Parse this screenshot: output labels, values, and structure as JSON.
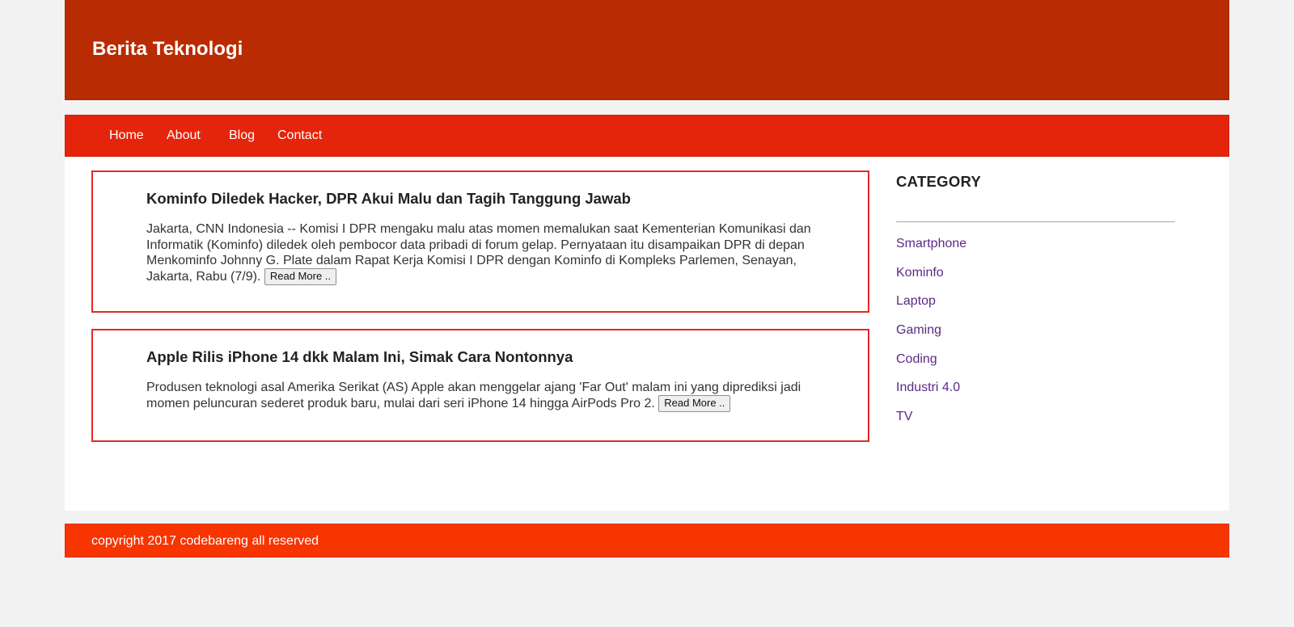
{
  "header": {
    "site_title": "Berita Teknologi"
  },
  "nav": {
    "items": [
      {
        "label": "Home"
      },
      {
        "label": "About"
      },
      {
        "label": "Blog"
      },
      {
        "label": "Contact"
      }
    ]
  },
  "articles": [
    {
      "title": "Kominfo Diledek Hacker, DPR Akui Malu dan Tagih Tanggung Jawab",
      "excerpt": "Jakarta, CNN Indonesia -- Komisi I DPR mengaku malu atas momen memalukan saat Kementerian Komunikasi dan Informatik (Kominfo) diledek oleh pembocor data pribadi di forum gelap. Pernyataan itu disampaikan DPR di depan Menkominfo Johnny G. Plate dalam Rapat Kerja Komisi I DPR dengan Kominfo di Kompleks Parlemen, Senayan, Jakarta, Rabu (7/9).",
      "read_more_label": "Read More .."
    },
    {
      "title": "Apple Rilis iPhone 14 dkk Malam Ini, Simak Cara Nontonnya",
      "excerpt": "Produsen teknologi asal Amerika Serikat (AS) Apple akan menggelar ajang 'Far Out' malam ini yang diprediksi jadi momen peluncuran sederet produk baru, mulai dari seri iPhone 14 hingga AirPods Pro 2.",
      "read_more_label": "Read More .."
    }
  ],
  "sidebar": {
    "title": "CATEGORY",
    "categories": [
      {
        "label": "Smartphone"
      },
      {
        "label": "Kominfo"
      },
      {
        "label": "Laptop"
      },
      {
        "label": "Gaming"
      },
      {
        "label": "Coding"
      },
      {
        "label": "Industri 4.0"
      },
      {
        "label": "TV"
      }
    ]
  },
  "footer": {
    "text": "copyright 2017 codebareng all reserved"
  },
  "colors": {
    "header_bg": "#b92b03",
    "nav_bg": "#e5240c",
    "footer_bg": "#f73500",
    "article_border": "#de2a2a",
    "category_link": "#5b2a86"
  }
}
